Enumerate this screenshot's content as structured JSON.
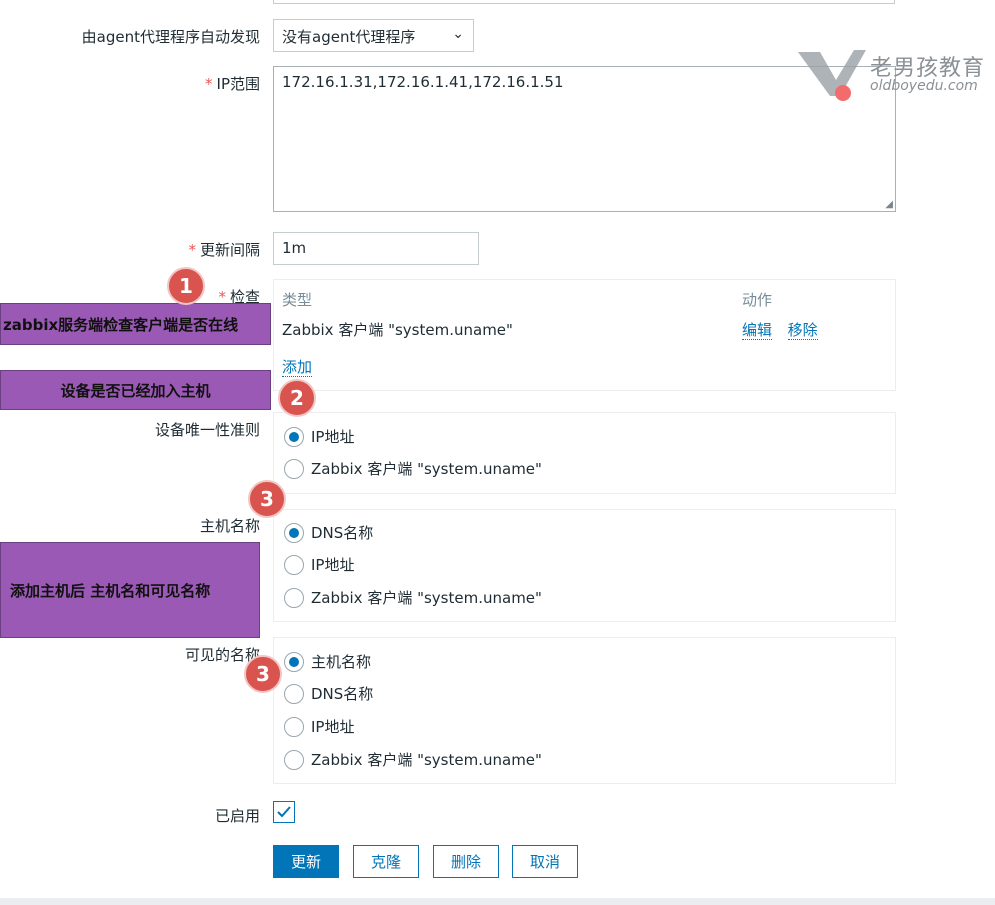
{
  "form": {
    "discovery_label": "由agent代理程序自动发现",
    "discovery_value": "没有agent代理程序",
    "ip_range_label": "IP范围",
    "ip_range_value": "172.16.1.31,172.16.1.41,172.16.1.51",
    "interval_label": "更新间隔",
    "interval_value": "1m",
    "checks_label": "检查",
    "checks": {
      "col_type": "类型",
      "col_action": "动作",
      "rows": [
        {
          "type": "Zabbix 客户端 \"system.uname\"",
          "edit": "编辑",
          "remove": "移除"
        }
      ],
      "add": "添加"
    },
    "uniqueness_label": "设备唯一性准则",
    "uniqueness_options": [
      "IP地址",
      "Zabbix 客户端 \"system.uname\""
    ],
    "hostname_label": "主机名称",
    "hostname_options": [
      "DNS名称",
      "IP地址",
      "Zabbix 客户端 \"system.uname\""
    ],
    "visible_label": "可见的名称",
    "visible_options": [
      "主机名称",
      "DNS名称",
      "IP地址",
      "Zabbix 客户端 \"system.uname\""
    ],
    "enabled_label": "已启用",
    "enabled": true,
    "buttons": {
      "update": "更新",
      "clone": "克隆",
      "delete": "删除",
      "cancel": "取消"
    }
  },
  "annotations": {
    "callout1": "zabbix服务端检查客户端是否在线",
    "callout2": "设备是否已经加入主机",
    "callout3": "添加主机后 主机名和可见名称",
    "badge1": "1",
    "badge2": "2",
    "badge3a": "3",
    "badge3b": "3"
  },
  "watermark": {
    "title": "老男孩教育",
    "url": "oldboyedu.com"
  },
  "colors": {
    "accent": "#0275b8",
    "callout": "#9b59b6",
    "badge": "#d9534f"
  }
}
